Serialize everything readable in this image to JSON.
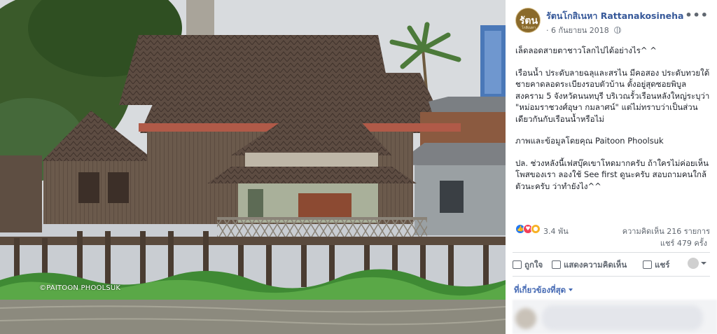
{
  "photo": {
    "watermark": "©PAITOON PHOOLSUK"
  },
  "post": {
    "page_name": "รัตนโกสิเนหา Rattanakosineha",
    "date": "6 กันยายน 2018",
    "date_separator": "·",
    "avatar_text": "รัตน",
    "avatar_subtext": "โกสิเนหา",
    "more_label": "•••",
    "paragraphs": [
      "เล็ดลอดสายตาชาวโลกไปได้อย่างไร^ ^",
      "เรือนน้ำ ประดับลายฉลุและสรไน มีคอสอง ประดับทวยใต้ชายคาดลอดระเบียงรอบตัวบ้าน ตั้งอยู่สุดซอยพิบูลสงคราม 5 จังหวัดนนทบุรี บริเวณรั้วเรือนหลังใหญ่ระบุว่า \"หม่อมราชวงศ์อุษา กมลาศน์\" แต่ไม่ทราบว่าเป็นส่วนเดียวกันกับเรือนน้ำหรือไม่",
      "ภาพและข้อมูลโดยคุณ Paitoon Phoolsuk",
      "ปล. ช่วงหลังนี้เฟสบุ๊คเขาโหดมากครับ ถ้าใครไม่ค่อยเห็นโพสของเรา ลองใช้ See first ดูนะครับ สอบถามคนใกล้ตัวนะครับ ว่าทำยังไง^^"
    ],
    "reactions": {
      "count": "3.4 พัน",
      "icons": [
        "like-icon",
        "love-icon",
        "wow-icon"
      ],
      "comments": "ความคิดเห็น 216 รายการ",
      "shares": "แชร์ 479 ครั้ง"
    },
    "actions": {
      "like": "ถูกใจ",
      "comment": "แสดงความคิดเห็น",
      "share": "แชร์"
    },
    "relevant_label": "ที่เกี่ยวข้องที่สุด"
  },
  "colors": {
    "link_blue": "#365899",
    "accent_blue": "#4267b2",
    "meta_gray": "#616770",
    "text": "#1d2129",
    "like_blue": "#2078f4",
    "love_red": "#f33e58",
    "wow_yellow": "#f7b125"
  }
}
